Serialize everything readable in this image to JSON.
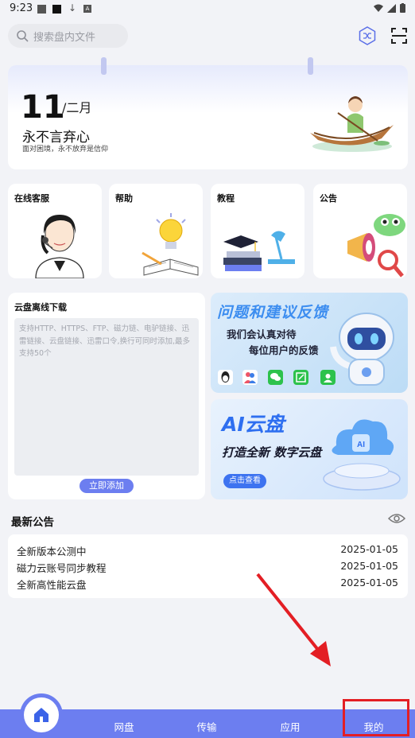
{
  "status": {
    "time": "9:23"
  },
  "search": {
    "placeholder": "搜索盘内文件"
  },
  "calendar": {
    "day": "11",
    "month": "/二月",
    "motto": "永不言弃心",
    "sub": "面对困境，永不放弃是信仰"
  },
  "tiles": [
    {
      "label": "在线客服"
    },
    {
      "label": "帮助"
    },
    {
      "label": "教程"
    },
    {
      "label": "公告"
    }
  ],
  "offline": {
    "title": "云盘离线下载",
    "placeholder": "支持HTTP、HTTPS、FTP、磁力链、电驴链接、迅雷链接、云盘链接、迅雷口令,换行可同时添加,最多支持50个",
    "button": "立即添加"
  },
  "feedback_banner": {
    "title": "问题和建议反馈",
    "line1": "我们会认真对待",
    "line2": "每位用户的反馈"
  },
  "ai_banner": {
    "title": "AI云盘",
    "subtitle": "打造全新 数字云盘",
    "button": "点击查看"
  },
  "announcements": {
    "heading": "最新公告",
    "items": [
      {
        "title": "全新版本公测中",
        "date": "2025-01-05"
      },
      {
        "title": "磁力云账号同步教程",
        "date": "2025-01-05"
      },
      {
        "title": "全新高性能云盘",
        "date": "2025-01-05"
      }
    ]
  },
  "nav": {
    "items": [
      {
        "label": "网盘"
      },
      {
        "label": "传输"
      },
      {
        "label": "应用"
      },
      {
        "label": "我的"
      }
    ]
  },
  "colors": {
    "accent": "#6c7ef0",
    "highlight": "#e31e24"
  }
}
